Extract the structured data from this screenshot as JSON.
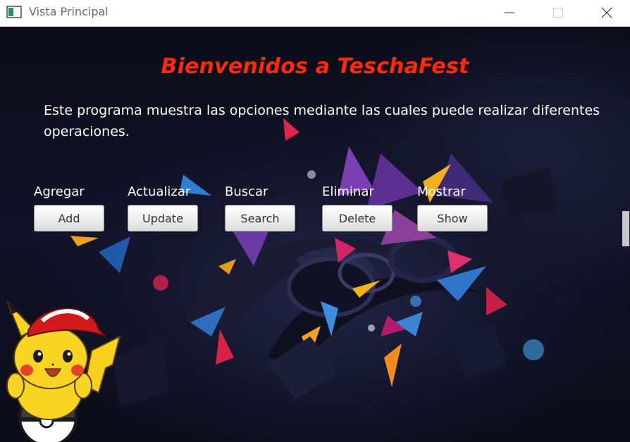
{
  "window": {
    "title": "Vista Principal",
    "icons": {
      "app": "window-icon",
      "minimize": "minimize-icon",
      "maximize": "maximize-icon",
      "close": "close-icon"
    }
  },
  "main": {
    "heading": "Bienvenidos a TeschaFest",
    "heading_color": "#ff2a00",
    "description": "Este programa muestra las opciones mediante las cuales puede realizar diferentes operaciones.",
    "actions": [
      {
        "label": "Agregar",
        "button": "Add"
      },
      {
        "label": "Actualizar",
        "button": "Update"
      },
      {
        "label": "Buscar",
        "button": "Search"
      },
      {
        "label": "Eliminar",
        "button": "Delete"
      },
      {
        "label": "Mostrar",
        "button": "Show"
      }
    ]
  },
  "decor": {
    "background": "abstract-dark-wallpaper",
    "mascot": "pikachu-with-red-cap-on-pokeball"
  }
}
